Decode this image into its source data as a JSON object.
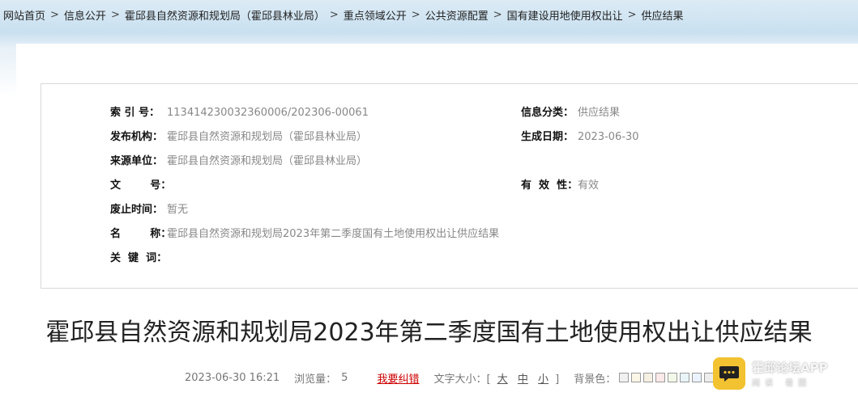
{
  "breadcrumb": [
    "网站首页",
    "信息公开",
    "霍邱县自然资源和规划局（霍邱县林业局）",
    "重点领域公开",
    "公共资源配置",
    "国有建设用地使用权出让",
    "供应结果"
  ],
  "breadcrumb_sep": ">",
  "meta": {
    "index_label": "索  引  号：",
    "index_value": "113414230032360006/202306-00061",
    "category_label": "信息分类：",
    "category_value": "供应结果",
    "publisher_label": "发布机构：",
    "publisher_value": "霍邱县自然资源和规划局（霍邱县林业局）",
    "gen_date_label": "生成日期：",
    "gen_date_value": "2023-06-30",
    "source_label": "来源单位：",
    "source_value": "霍邱县自然资源和规划局（霍邱县林业局）",
    "docno_label": "文        号：",
    "docno_value": "",
    "validity_label": "有  效  性：",
    "validity_value": "有效",
    "repeal_label": "废止时间：",
    "repeal_value": "暂无",
    "name_label": "名        称：",
    "name_value": "霍邱县自然资源和规划局2023年第二季度国有土地使用权出让供应结果",
    "keywords_label": "关  键  词：",
    "keywords_value": ""
  },
  "article": {
    "title": "霍邱县自然资源和规划局2023年第二季度国有土地使用权出让供应结果",
    "datetime": "2023-06-30 16:21",
    "views_label": "浏览量：",
    "views": "5",
    "report_error": "我要纠错",
    "font_size_label": "文字大小：[",
    "font_large": "大",
    "font_medium": "中",
    "font_small": "小",
    "font_size_close": "]",
    "bg_label": "背景色："
  },
  "swatch_colors": [
    "#f0f0f0",
    "#fbf6e6",
    "#f6f0e2",
    "#fbe8e8",
    "#f2f8e8",
    "#e8f4f8",
    "#eaf2ff",
    "#ededed"
  ],
  "badge": {
    "title": "霍邱论坛APP",
    "subtitle": "阅读 看图"
  }
}
